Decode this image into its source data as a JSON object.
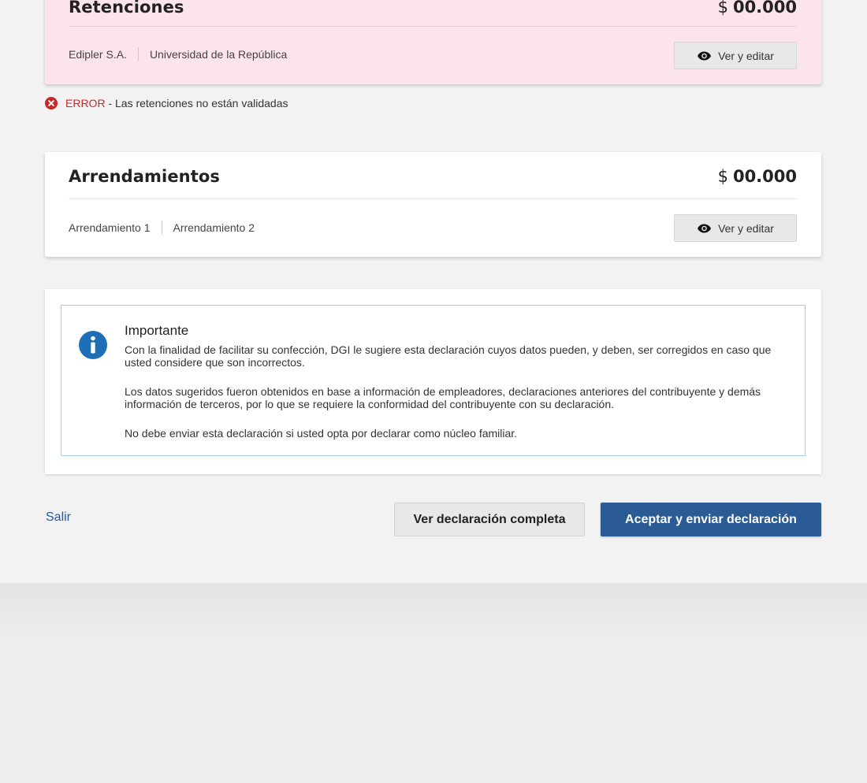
{
  "retenciones": {
    "title": "Retenciones",
    "currency": "$",
    "amount": "00.000",
    "payers": [
      "Edipler S.A.",
      "Universidad de la República"
    ],
    "button_label": "Ver y editar",
    "button_icon": "eye-icon",
    "background_color": "#fce4ec"
  },
  "error": {
    "icon": "error-circle-icon",
    "tag": "ERROR",
    "message": " - Las retenciones no están validadas",
    "color": "#c62828"
  },
  "arrendamientos": {
    "title": "Arrendamientos",
    "currency": "$",
    "amount": "00.000",
    "items": [
      "Arrendamiento 1",
      "Arrendamiento 2"
    ],
    "button_label": "Ver y editar",
    "button_icon": "eye-icon"
  },
  "info": {
    "icon": "info-circle-icon",
    "title": "Importante",
    "paragraphs": [
      "Con la finalidad de facilitar su confección, DGI le sugiere esta declaración cuyos datos pueden, y deben, ser corregidos en caso que usted considere que son incorrectos.",
      "Los datos sugeridos fueron obtenidos en base a información de empleadores, declaraciones anteriores del contribuyente y demás información de terceros, por lo que se requiere la conformidad del contribuyente con su declaración.",
      "No debe enviar esta declaración si usted opta por declarar como núcleo familiar."
    ],
    "border_color": "#a9cde6",
    "icon_color": "#1e6fb5"
  },
  "actions": {
    "exit_label": "Salir",
    "view_full_label": "Ver declaración completa",
    "accept_label": "Aceptar y enviar declaración",
    "primary_color": "#2b5b94",
    "link_color": "#2b5797"
  }
}
